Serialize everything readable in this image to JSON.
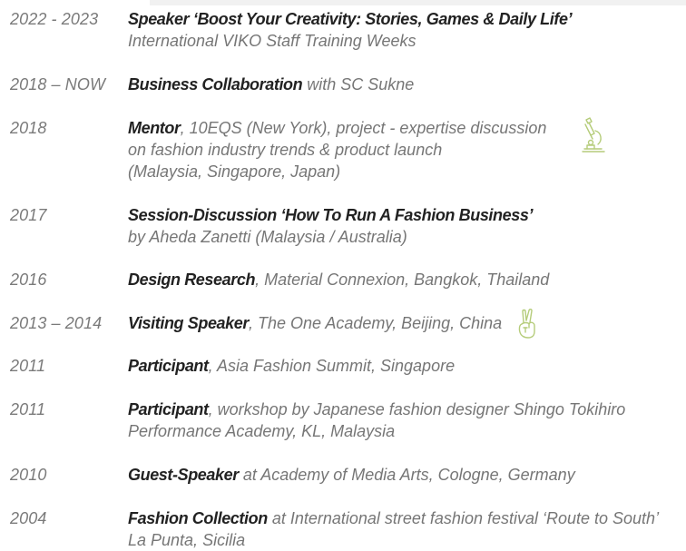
{
  "colors": {
    "text_muted": "#767676",
    "text_strong": "#222222",
    "icon_accent": "#b5cc7a"
  },
  "entries": [
    {
      "year": "2022 - 2023",
      "role": "Speaker ‘Boost Your Creativity: Stories, Games & Daily Life’",
      "rest": "",
      "line2": "International VIKO Staff Training Weeks",
      "line3": ""
    },
    {
      "year": "2018 – NOW",
      "role": "Business Collaboration",
      "rest": " with SC Sukne",
      "line2": "",
      "line3": ""
    },
    {
      "year": "2018",
      "role": "Mentor",
      "rest": ", 10EQS (New York), project - expertise discussion",
      "line2": "on fashion industry trends & product launch",
      "line3": "(Malaysia, Singapore, Japan)",
      "icon": "microscope-icon"
    },
    {
      "year": "2017",
      "role": "Session-Discussion ‘How To Run A Fashion Business’",
      "rest": "",
      "line2": "by Aheda Zanetti (Malaysia / Australia)",
      "line3": ""
    },
    {
      "year": "2016",
      "role": "Design Research",
      "rest": ", Material Connexion, Bangkok, Thailand",
      "line2": "",
      "line3": ""
    },
    {
      "year": "2013 – 2014",
      "role": "Visiting Speaker",
      "rest": ", The One Academy, Beijing, China",
      "line2": "",
      "line3": "",
      "icon": "peace-hand-icon"
    },
    {
      "year": "2011",
      "role": "Participant",
      "rest": ", Asia Fashion Summit, Singapore",
      "line2": "",
      "line3": ""
    },
    {
      "year": "2011",
      "role": "Participant",
      "rest": ", workshop by Japanese fashion designer Shingo Tokihiro",
      "line2": "Performance Academy, KL, Malaysia",
      "line3": ""
    },
    {
      "year": "2010",
      "role": "Guest-Speaker",
      "rest": " at Academy of Media Arts, Cologne, Germany",
      "line2": "",
      "line3": ""
    },
    {
      "year": "2004",
      "role": "Fashion Collection",
      "rest": " at International street fashion festival ‘Route to South’",
      "line2": "La Punta, Sicilia",
      "line3": ""
    }
  ]
}
